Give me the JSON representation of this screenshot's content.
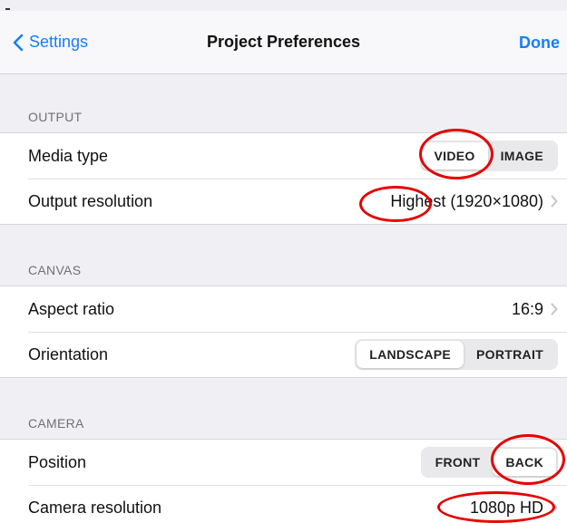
{
  "nav": {
    "back_label": "Settings",
    "title": "Project Preferences",
    "done_label": "Done"
  },
  "sections": {
    "output": {
      "header": "OUTPUT",
      "media_type": {
        "label": "Media type",
        "options": [
          "VIDEO",
          "IMAGE"
        ],
        "selected": "VIDEO"
      },
      "output_resolution": {
        "label": "Output resolution",
        "value": "Highest (1920×1080)"
      }
    },
    "canvas": {
      "header": "CANVAS",
      "aspect_ratio": {
        "label": "Aspect ratio",
        "value": "16:9"
      },
      "orientation": {
        "label": "Orientation",
        "options": [
          "LANDSCAPE",
          "PORTRAIT"
        ],
        "selected": "LANDSCAPE"
      }
    },
    "camera": {
      "header": "CAMERA",
      "position": {
        "label": "Position",
        "options": [
          "FRONT",
          "BACK"
        ],
        "selected": "BACK"
      },
      "camera_resolution": {
        "label": "Camera resolution",
        "value": "1080p HD"
      }
    }
  },
  "icons": {
    "back": "chevron-left-icon",
    "disclosure": "chevron-right-icon"
  },
  "colors": {
    "accent": "#157efb",
    "annotation": "#e60000",
    "background": "#efeff4",
    "secondary_text": "#707075"
  }
}
